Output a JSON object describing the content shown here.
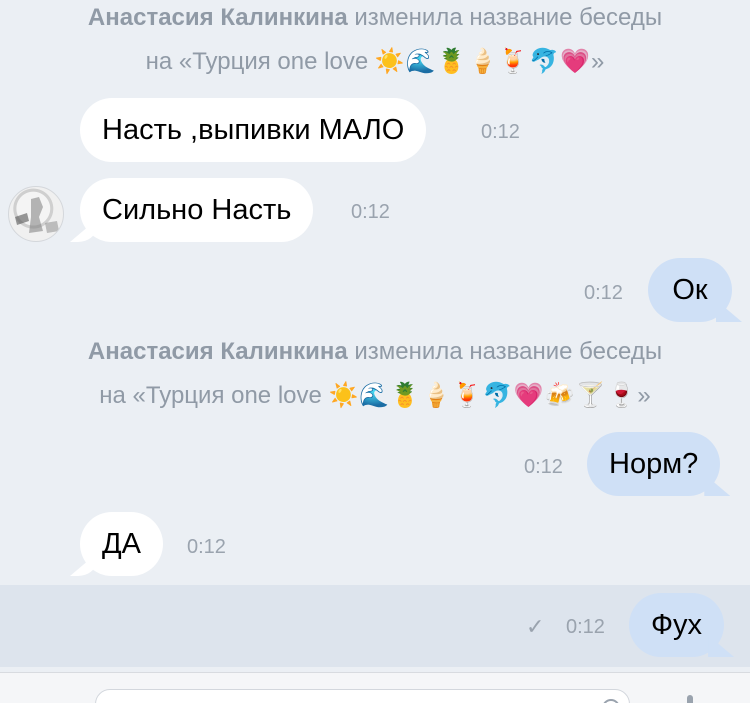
{
  "system_messages": [
    {
      "author": "Анастасия Калинкина",
      "action": "изменила название беседы",
      "prefix": "на «Турция one love ",
      "emojis": "☀️🌊🍍🍦🍹🐬💗",
      "suffix": "»"
    },
    {
      "author": "Анастасия Калинкина",
      "action": "изменила название беседы",
      "prefix": "на «Турция one love ",
      "emojis": "☀️🌊🍍🍦🍹🐬💗🍻🍸🍷",
      "suffix": "»"
    }
  ],
  "messages": [
    {
      "text": "Насть ,выпивки МАЛО",
      "time": "0:12",
      "direction": "incoming"
    },
    {
      "text": "Сильно Насть",
      "time": "0:12",
      "direction": "incoming"
    },
    {
      "text": "Ок",
      "time": "0:12",
      "direction": "outgoing"
    },
    {
      "text": "Норм?",
      "time": "0:12",
      "direction": "outgoing"
    },
    {
      "text": "ДА",
      "time": "0:12",
      "direction": "incoming"
    },
    {
      "text": "Фух",
      "time": "0:12",
      "direction": "outgoing",
      "status": "sent"
    }
  ],
  "composer": {
    "placeholder": "",
    "icons": [
      "attach-icon",
      "sticker-icon",
      "microphone-icon"
    ]
  },
  "colors": {
    "background": "#ebeff4",
    "incoming_bubble": "#ffffff",
    "outgoing_bubble": "#cfe0f6",
    "system_text": "#909aa6",
    "selected_row": "#dde4ed"
  }
}
